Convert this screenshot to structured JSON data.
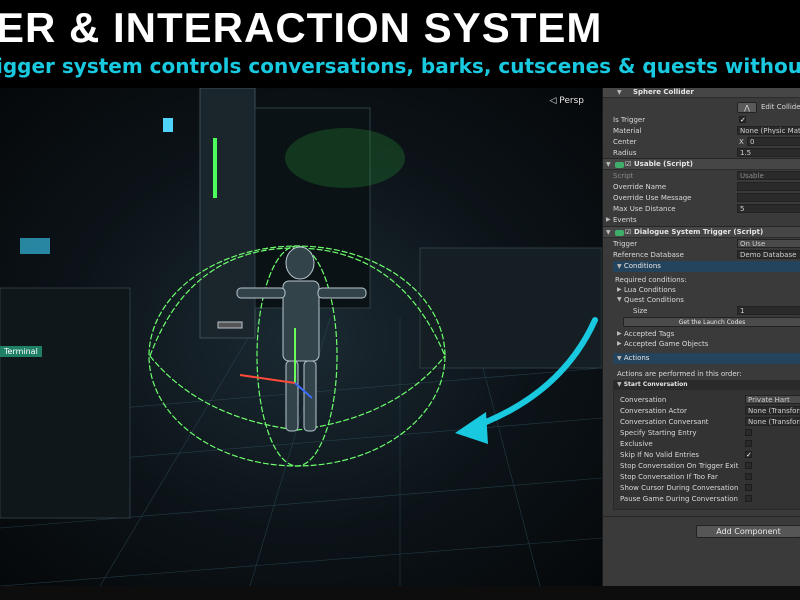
{
  "banner": {
    "title": "ER & INTERACTION SYSTEM",
    "subtitle": "igger system controls conversations, barks, cutscenes & quests without a single line"
  },
  "scene": {
    "view_mode": "Persp",
    "terminal_label": "Terminal"
  },
  "inspector": {
    "sphere_collider": {
      "header": "Sphere Collider",
      "edit_collider": "Edit Collider",
      "is_trigger_label": "Is Trigger",
      "material_label": "Material",
      "material_value": "None (Physic Mate",
      "center_label": "Center",
      "center_x_label": "X",
      "center_x_value": "0",
      "radius_label": "Radius",
      "radius_value": "1.5"
    },
    "usable": {
      "header": "Usable (Script)",
      "script_label": "Script",
      "script_value": "Usable",
      "override_name_label": "Override Name",
      "override_use_message_label": "Override Use Message",
      "max_use_distance_label": "Max Use Distance",
      "max_use_distance_value": "5",
      "events_label": "Events"
    },
    "trigger": {
      "header": "Dialogue System Trigger (Script)",
      "trigger_label": "Trigger",
      "trigger_value": "On Use",
      "reference_database_label": "Reference Database",
      "reference_database_value": "Demo Database",
      "conditions_header": "Conditions",
      "required_conditions": "Required conditions:",
      "lua_conditions": "Lua Conditions",
      "quest_conditions": "Quest Conditions",
      "size_label": "Size",
      "size_value": "1",
      "launch_codes_button": "Get the Launch Codes",
      "accepted_tags": "Accepted Tags",
      "accepted_game_objects": "Accepted Game Objects",
      "actions_header": "Actions",
      "actions_note": "Actions are performed in this order:",
      "start_conversation_header": "Start Conversation",
      "fields": [
        {
          "label": "Conversation",
          "value": "Private Hart"
        },
        {
          "label": "Conversation Actor",
          "value": "None (Transform"
        },
        {
          "label": "Conversation Conversant",
          "value": "None (Transform"
        }
      ],
      "checkboxes": [
        {
          "label": "Specify Starting Entry",
          "checked": false
        },
        {
          "label": "Exclusive",
          "checked": false
        },
        {
          "label": "Skip If No Valid Entries",
          "checked": true
        },
        {
          "label": "Stop Conversation On Trigger Exit",
          "checked": false
        },
        {
          "label": "Stop Conversation If Too Far",
          "checked": false
        },
        {
          "label": "Show Cursor During Conversation",
          "checked": false
        },
        {
          "label": "Pause Game During Conversation",
          "checked": false
        }
      ]
    },
    "add_component": "Add Component",
    "check_glyph": "✓"
  },
  "colors": {
    "accent_cyan": "#18c9e0",
    "gizmo_green": "#6dff6d",
    "inspector_bg": "#3a3a3a",
    "section_blue": "#24435c"
  }
}
